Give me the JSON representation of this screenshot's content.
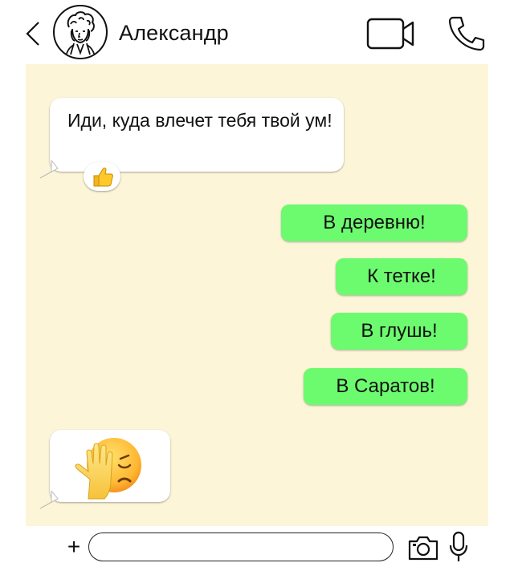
{
  "header": {
    "contact_name": "Александр",
    "icons": {
      "back": "chevron-left-icon",
      "avatar": "avatar-portrait",
      "video": "video-camera-icon",
      "call": "phone-icon"
    }
  },
  "chat": {
    "background": "#fdf5d8",
    "incoming_bubble_color": "#ffffff",
    "outgoing_bubble_color": "#6cfb6e",
    "messages": [
      {
        "direction": "incoming",
        "text": "Иди, куда влечет тебя твой ум!",
        "reaction": "thumbs-up-emoji"
      },
      {
        "direction": "outgoing",
        "text": "В деревню!"
      },
      {
        "direction": "outgoing",
        "text": "К тетке!"
      },
      {
        "direction": "outgoing",
        "text": "В глушь!"
      },
      {
        "direction": "outgoing",
        "text": "В Саратов!"
      },
      {
        "direction": "incoming",
        "emoji": "face-palm-emoji"
      }
    ]
  },
  "input_bar": {
    "value": "",
    "placeholder": "",
    "icons": {
      "attach": "plus-icon",
      "camera": "camera-icon",
      "mic": "microphone-icon"
    },
    "attach_label": "+"
  }
}
